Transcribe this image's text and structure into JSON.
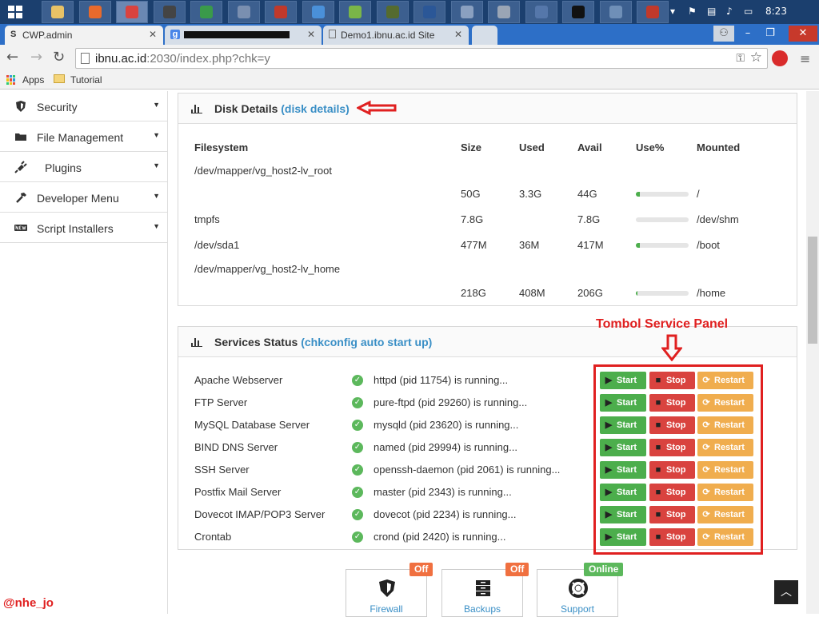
{
  "taskbar": {
    "clock": "8:23",
    "apps": [
      "explorer",
      "firefox",
      "chrome",
      "putty",
      "app-green",
      "virtualbox",
      "filezilla",
      "paint",
      "vpn",
      "app-bird",
      "word",
      "app-globe",
      "app-grid",
      "app-remote",
      "cmd",
      "app-monitor",
      "app-red"
    ]
  },
  "tabs": [
    {
      "label": "CWP.admin",
      "favicon": "S"
    },
    {
      "label": "",
      "favicon": "g"
    },
    {
      "label": "Demo1.ibnu.ac.id Site",
      "favicon": "doc"
    }
  ],
  "address": {
    "host": "ibnu.ac.id",
    "rest": ":2030/index.php?chk=y"
  },
  "bookmarks": [
    {
      "label": "Apps"
    },
    {
      "label": "Tutorial"
    }
  ],
  "sidebar": {
    "items": [
      {
        "label": "Security",
        "icon": "shield-icon"
      },
      {
        "label": "File Management",
        "icon": "folder-icon"
      },
      {
        "label": "Plugins",
        "icon": "plug-icon"
      },
      {
        "label": "Developer Menu",
        "icon": "hammer-icon"
      },
      {
        "label": "Script Installers",
        "icon": "new-icon"
      }
    ]
  },
  "disk": {
    "title": "Disk Details",
    "link": "(disk details)",
    "headers": {
      "filesystem": "Filesystem",
      "size": "Size",
      "used": "Used",
      "avail": "Avail",
      "use": "Use%",
      "mounted": "Mounted"
    },
    "rows": [
      {
        "filesystem": "/dev/mapper/vg_host2-lv_root",
        "size": "",
        "used": "",
        "avail": "",
        "use": null,
        "mounted": ""
      },
      {
        "filesystem": "",
        "size": "50G",
        "used": "3.3G",
        "avail": "44G",
        "use": 0.07,
        "mounted": "/"
      },
      {
        "filesystem": "tmpfs",
        "size": "7.8G",
        "used": "",
        "avail": "7.8G",
        "use": 0.0,
        "mounted": "/dev/shm"
      },
      {
        "filesystem": "/dev/sda1",
        "size": "477M",
        "used": "36M",
        "avail": "417M",
        "use": 0.08,
        "mounted": "/boot"
      },
      {
        "filesystem": "/dev/mapper/vg_host2-lv_home",
        "size": "",
        "used": "",
        "avail": "",
        "use": null,
        "mounted": ""
      },
      {
        "filesystem": "",
        "size": "218G",
        "used": "408M",
        "avail": "206G",
        "use": 0.01,
        "mounted": "/home"
      }
    ]
  },
  "services": {
    "title": "Services Status",
    "link": "(chkconfig auto start up)",
    "buttons": {
      "start": "Start",
      "stop": "Stop",
      "restart": "Restart"
    },
    "rows": [
      {
        "name": "Apache Webserver",
        "status": "httpd (pid 11754) is running..."
      },
      {
        "name": "FTP Server",
        "status": "pure-ftpd (pid 29260) is running..."
      },
      {
        "name": "MySQL Database Server",
        "status": "mysqld (pid 23620) is running..."
      },
      {
        "name": "BIND DNS Server",
        "status": "named (pid 29994) is running..."
      },
      {
        "name": "SSH Server",
        "status": "openssh-daemon (pid 2061) is running..."
      },
      {
        "name": "Postfix Mail Server",
        "status": "master (pid 2343) is running..."
      },
      {
        "name": "Dovecot IMAP/POP3 Server",
        "status": "dovecot (pid 2234) is running..."
      },
      {
        "name": "Crontab",
        "status": "crond (pid 2420) is running..."
      }
    ]
  },
  "annotation": {
    "label": "Tombol Service Panel"
  },
  "tiles": [
    {
      "label": "Firewall",
      "badge": "Off",
      "badge_color": "#f07040",
      "icon": "shield-icon"
    },
    {
      "label": "Backups",
      "badge": "Off",
      "badge_color": "#f07040",
      "icon": "server-icon"
    },
    {
      "label": "Support",
      "badge": "Online",
      "badge_color": "#5cb85c",
      "icon": "lifebuoy-icon"
    }
  ],
  "watermark": "@nhe_jo",
  "colors": {
    "accent": "#3a8fc6",
    "start": "#4cae4c",
    "stop": "#d9433f",
    "restart": "#f0ad4e",
    "annotation": "#e02020"
  }
}
